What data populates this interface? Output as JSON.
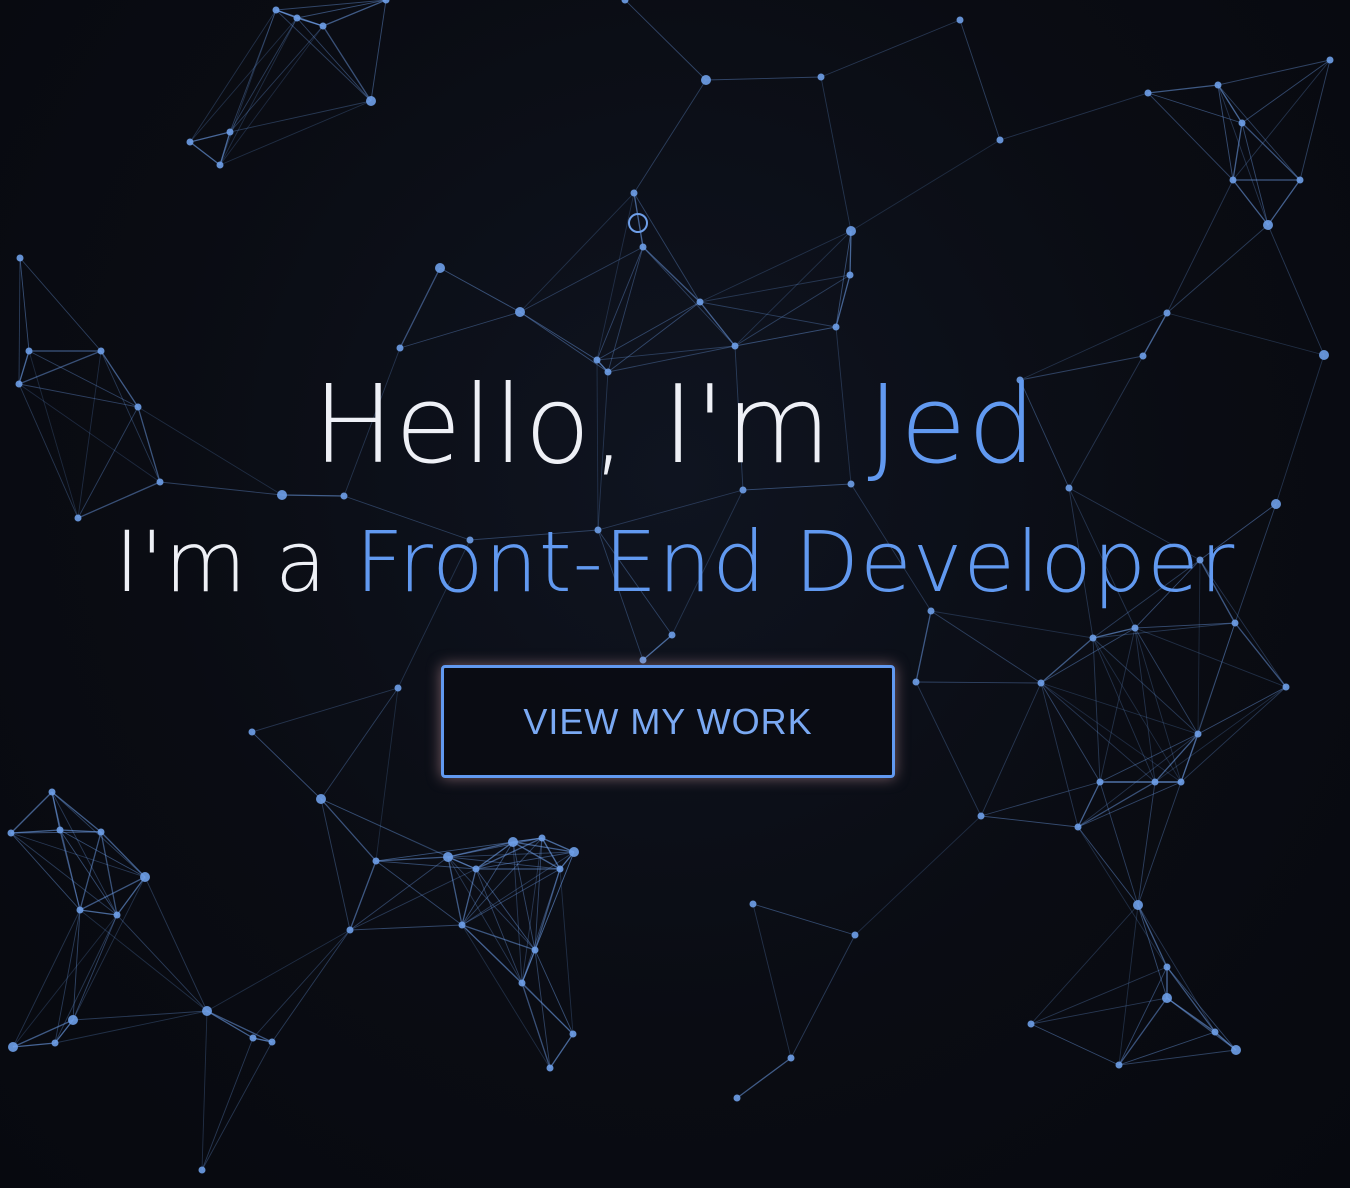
{
  "hero": {
    "greeting_prefix": "Hello, I'm ",
    "name": "Jed",
    "role_prefix": "I'm a ",
    "role": "Front-End Developer",
    "cta_label": "VIEW MY WORK"
  },
  "colors": {
    "background": "#0a0c13",
    "accent": "#6199f0",
    "text": "#eef0f6",
    "network": "#6e9ee8",
    "button_glow": "#d6a0aa"
  }
}
